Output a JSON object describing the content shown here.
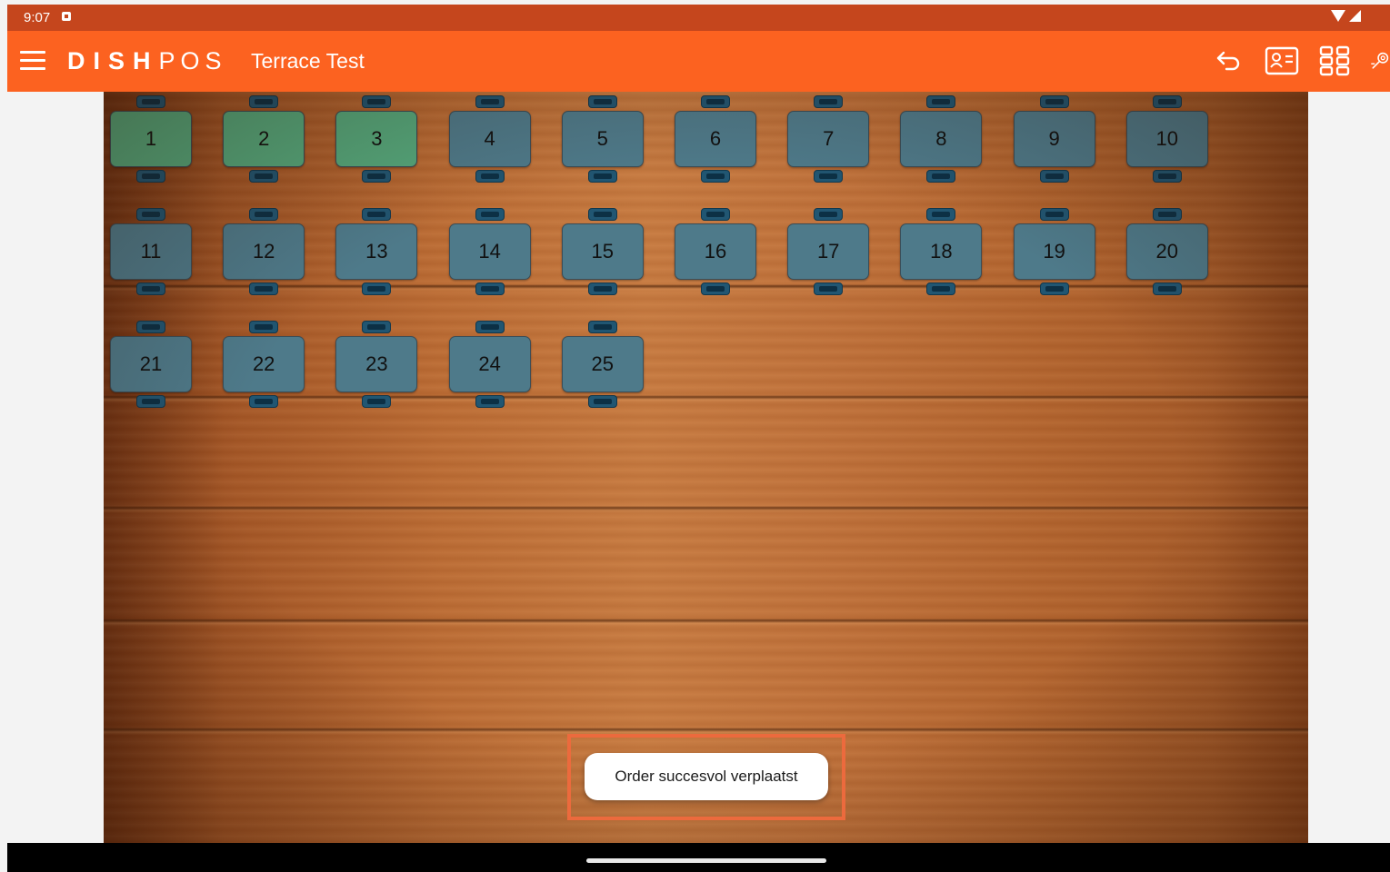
{
  "status_bar": {
    "time": "9:07"
  },
  "app_bar": {
    "brand_bold": "DISH",
    "brand_light": "POS",
    "location": "Terrace Test"
  },
  "colors": {
    "app_bar": "#fc6220",
    "status_bar": "#c5461d",
    "table_occupied": "#55a97d",
    "table_free": "#4e7a8a",
    "chair": "#215672"
  },
  "tables": [
    {
      "label": "1",
      "status": "occupied"
    },
    {
      "label": "2",
      "status": "occupied"
    },
    {
      "label": "3",
      "status": "occupied"
    },
    {
      "label": "4",
      "status": "free"
    },
    {
      "label": "5",
      "status": "free"
    },
    {
      "label": "6",
      "status": "free"
    },
    {
      "label": "7",
      "status": "free"
    },
    {
      "label": "8",
      "status": "free"
    },
    {
      "label": "9",
      "status": "free"
    },
    {
      "label": "10",
      "status": "free"
    },
    {
      "label": "11",
      "status": "free"
    },
    {
      "label": "12",
      "status": "free"
    },
    {
      "label": "13",
      "status": "free"
    },
    {
      "label": "14",
      "status": "free"
    },
    {
      "label": "15",
      "status": "free"
    },
    {
      "label": "16",
      "status": "free"
    },
    {
      "label": "17",
      "status": "free"
    },
    {
      "label": "18",
      "status": "free"
    },
    {
      "label": "19",
      "status": "free"
    },
    {
      "label": "20",
      "status": "free"
    },
    {
      "label": "21",
      "status": "free"
    },
    {
      "label": "22",
      "status": "free"
    },
    {
      "label": "23",
      "status": "free"
    },
    {
      "label": "24",
      "status": "free"
    },
    {
      "label": "25",
      "status": "free"
    }
  ],
  "toast": {
    "message": "Order succesvol verplaatst"
  }
}
